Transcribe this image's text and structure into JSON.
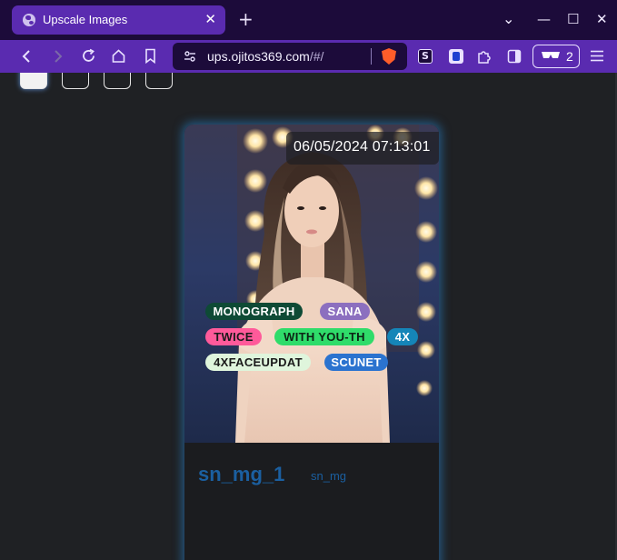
{
  "browser": {
    "tab_title": "Upscale Images",
    "tab_close": "✕",
    "new_tab": "+",
    "url_host": "ups.ojitos369.com",
    "url_path": "/#/",
    "shields_count": "2",
    "window_controls": {
      "minimize": "—",
      "maximize": "☐",
      "close": "✕",
      "tab_list": "⌄"
    },
    "icons": [
      "back-icon",
      "forward-icon",
      "reload-icon",
      "home-icon",
      "bookmark-icon",
      "site-info-icon",
      "brave-shields-icon",
      "extension-s-icon",
      "extension-bitwarden-icon",
      "extensions-puzzle-icon",
      "sidebar-icon",
      "private-glasses-icon",
      "menu-icon"
    ]
  },
  "page": {
    "card": {
      "date": "06/05/2024 07:13:01",
      "title": "sn_mg_1",
      "subtitle": "sn_mg",
      "tags": [
        {
          "label": "MONOGRAPH",
          "bg": "#0e4a35",
          "fg": "#ffffff"
        },
        {
          "label": "SANA",
          "bg": "#8c6fbf",
          "fg": "#ffffff"
        },
        {
          "label": "TWICE",
          "bg": "#ff5a9a",
          "fg": "#1a1a1a"
        },
        {
          "label": "WITH YOU-TH",
          "bg": "#2fdc6a",
          "fg": "#0c2414"
        },
        {
          "label": "4X",
          "bg": "#1585b8",
          "fg": "#ffffff"
        },
        {
          "label": "4XFACEUPDAT",
          "bg": "#dff5dc",
          "fg": "#1a1a1a"
        },
        {
          "label": "SCUNET",
          "bg": "#2b73cf",
          "fg": "#ffffff"
        }
      ]
    }
  },
  "colors": {
    "titlebar": "#1c0b3a",
    "toolbar": "#5a2bb0",
    "page_bg": "#1f2124",
    "card_glow": "#2882c8",
    "title_blue": "#1b5fa0"
  }
}
